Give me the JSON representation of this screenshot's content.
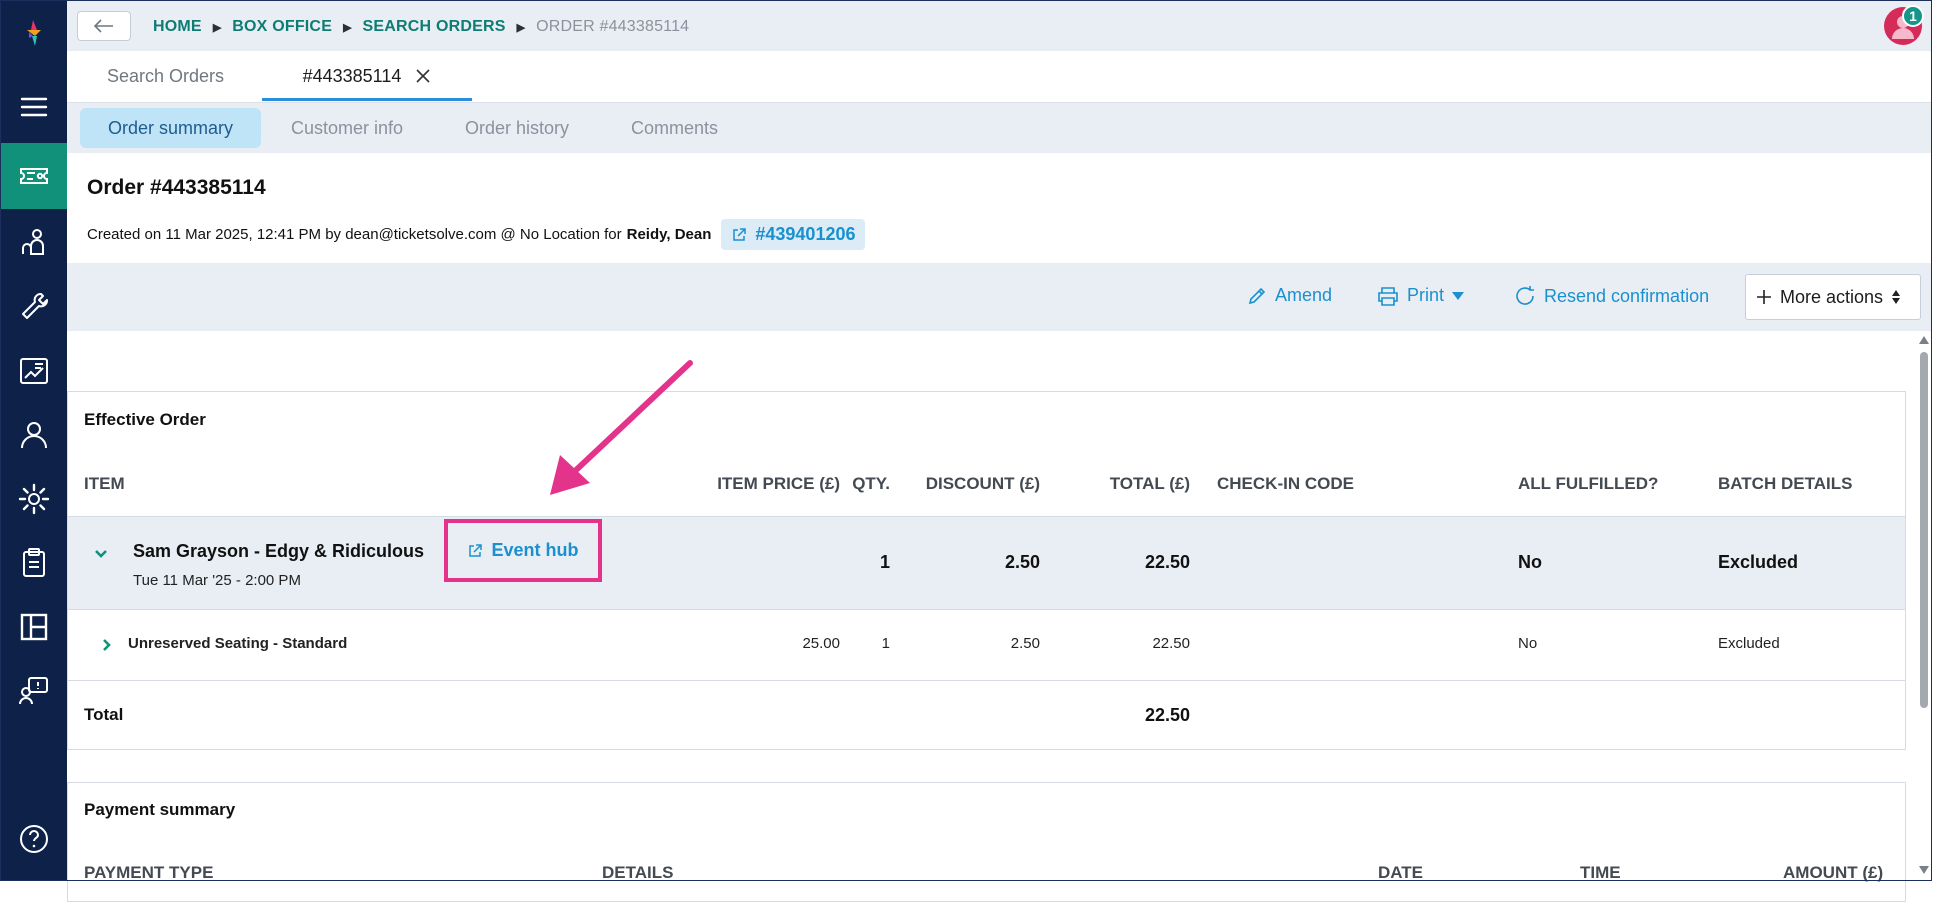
{
  "sidebar": {
    "items": [
      {
        "name": "logo"
      },
      {
        "name": "menu"
      },
      {
        "name": "box-office"
      },
      {
        "name": "people"
      },
      {
        "name": "tools"
      },
      {
        "name": "reports"
      },
      {
        "name": "user"
      },
      {
        "name": "settings"
      },
      {
        "name": "clipboard"
      },
      {
        "name": "layout"
      },
      {
        "name": "support"
      },
      {
        "name": "help"
      }
    ]
  },
  "header": {
    "breadcrumbs": [
      "HOME",
      "BOX OFFICE",
      "SEARCH ORDERS",
      "ORDER #443385114"
    ],
    "notification_count": "1"
  },
  "page_tabs": [
    {
      "label": "Search Orders"
    },
    {
      "label": "#443385114"
    }
  ],
  "sub_tabs": [
    {
      "label": "Order summary"
    },
    {
      "label": "Customer info"
    },
    {
      "label": "Order history"
    },
    {
      "label": "Comments"
    }
  ],
  "order": {
    "title": "Order #443385114",
    "created_text": "Created on 11 Mar 2025, 12:41 PM by dean@ticketsolve.com @ No Location for",
    "customer": "Reidy, Dean",
    "customer_ref": "#439401206"
  },
  "actions": {
    "amend": "Amend",
    "print": "Print",
    "resend": "Resend confirmation",
    "more": "More actions"
  },
  "effective_order": {
    "title": "Effective Order",
    "columns": [
      "ITEM",
      "ITEM PRICE (£)",
      "QTY.",
      "DISCOUNT (£)",
      "TOTAL (£)",
      "CHECK-IN CODE",
      "ALL FULFILLED?",
      "BATCH DETAILS"
    ],
    "event": {
      "name": "Sam Grayson - Edgy & Ridiculous",
      "date": "Tue 11 Mar '25 - 2:00 PM",
      "event_hub_label": "Event hub",
      "qty": "1",
      "discount": "2.50",
      "total": "22.50",
      "fulfilled": "No",
      "batch": "Excluded"
    },
    "line_item": {
      "name": "Unreserved Seating - Standard",
      "price": "25.00",
      "qty": "1",
      "discount": "2.50",
      "total": "22.50",
      "fulfilled": "No",
      "batch": "Excluded"
    },
    "total_label": "Total",
    "total_value": "22.50"
  },
  "payment_summary": {
    "title": "Payment summary",
    "columns": [
      "PAYMENT TYPE",
      "DETAILS",
      "DATE",
      "TIME",
      "AMOUNT (£)"
    ]
  },
  "colors": {
    "sidebar_bg": "#0e2148",
    "sidebar_active": "#12917a",
    "link_blue": "#1a90cf",
    "breadcrumb_teal": "#0d7d73",
    "highlight_pink": "#e4338a",
    "panel_gray": "#e9eef5"
  }
}
